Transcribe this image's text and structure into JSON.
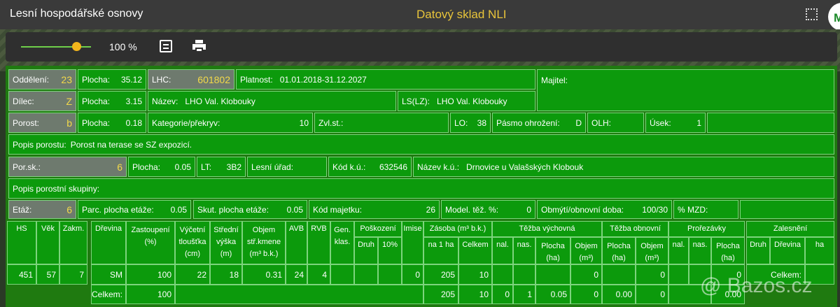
{
  "app": {
    "title": "Lesní hospodářské osnovy",
    "center_title": "Datový sklad NLI",
    "avatar_letter": "M"
  },
  "toolbar": {
    "zoom": "100 %",
    "zoom_percent": 100
  },
  "row1": {
    "oddeleni_label": "Oddělení:",
    "oddeleni_value": "23",
    "plocha_label": "Plocha:",
    "plocha_value": "35.12",
    "lhc_label": "LHC:",
    "lhc_value": "601802",
    "platnost_label": "Platnost:",
    "platnost_value": "01.01.2018-31.12.2027",
    "majitel_label": "Majitel:"
  },
  "row2": {
    "dilec_label": "Dílec:",
    "dilec_value": "Z",
    "plocha_label": "Plocha:",
    "plocha_value": "3.15",
    "nazev_label": "Název:",
    "nazev_value": "LHO Val. Klobouky",
    "ls_label": "LS(LZ):",
    "ls_value": "LHO Val. Klobouky"
  },
  "row3": {
    "porost_label": "Porost:",
    "porost_value": "b",
    "plocha_label": "Plocha:",
    "plocha_value": "0.18",
    "kategorie_label": "Kategorie/překryv:",
    "kategorie_value": "10",
    "zvl_label": "Zvl.st.:",
    "lo_label": "LO:",
    "lo_value": "38",
    "pasmo_label": "Pásmo ohrožení:",
    "pasmo_value": "D",
    "olh_label": "OLH:",
    "usek_label": "Úsek:",
    "usek_value": "1"
  },
  "row4": {
    "popis_label": "Popis porostu:",
    "popis_value": "Porost na terase se SZ expozicí."
  },
  "row5": {
    "porsk_label": "Por.sk.:",
    "porsk_value": "6",
    "plocha_label": "Plocha:",
    "plocha_value": "0.05",
    "lt_label": "LT:",
    "lt_value": "3B2",
    "urad_label": "Lesní úřad:",
    "kodku_label": "Kód k.ú.:",
    "kodku_value": "632546",
    "nazevku_label": "Název k.ú.:",
    "nazevku_value": "Drnovice u Valašských Klobouk"
  },
  "row6": {
    "popis_label": "Popis porostní skupiny:"
  },
  "row7": {
    "etaz_label": "Etáž:",
    "etaz_value": "6",
    "parc_label": "Parc. plocha etáže:",
    "parc_value": "0.05",
    "skut_label": "Skut. plocha etáže:",
    "skut_value": "0.05",
    "kodmaj_label": "Kód majetku:",
    "kodmaj_value": "26",
    "model_label": "Model. těž. %:",
    "model_value": "0",
    "obmyti_label": "Obmýtí/obnovní doba:",
    "obmyti_value": "100/30",
    "mzd_label": "% MZD:"
  },
  "table": {
    "h_hs": "HS",
    "h_vek": "Věk",
    "h_zakm": "Zakm.",
    "h_drevina": "Dřevina",
    "h_zast": "Zastoupení",
    "h_zast2": "(%)",
    "h_vyc": "Výčetní",
    "h_vyc2": "tloušťka",
    "h_vyc3": "(cm)",
    "h_str": "Střední",
    "h_str2": "výška",
    "h_str3": "(m)",
    "h_obj": "Objem",
    "h_obj2": "stř.kmene",
    "h_obj3": "(m³ b.k.)",
    "h_avb": "AVB",
    "h_rvb": "RVB",
    "h_gen": "Gen.",
    "h_gen2": "klas.",
    "h_posk": "Poškození",
    "h_druh": "Druh",
    "h_10": "10%",
    "h_imise": "Imise",
    "h_zasoba": "Zásoba (m³ b.k.)",
    "h_na1": "na 1 ha",
    "h_celkem": "Celkem",
    "h_tvych": "Těžba výchovná",
    "h_nal": "nal.",
    "h_nas": "nas.",
    "h_plocha": "Plocha",
    "h_ha": "(ha)",
    "h_objem": "Objem",
    "h_m3": "(m³)",
    "h_tobn": "Těžba obnovní",
    "h_proreз": "Prořezávky",
    "h_zales": "Zalesnění",
    "h_zdruh": "Druh",
    "h_zdrev": "Dřevina",
    "h_zha": "ha",
    "row": {
      "hs": "451",
      "vek": "57",
      "zakm": "7",
      "drevina": "SM",
      "zast": "100",
      "vyc": "22",
      "str": "18",
      "obj": "0.31",
      "avb": "24",
      "rvb": "4",
      "imise": "0",
      "na1": "205",
      "celkem": "10",
      "tv_obj": "0",
      "to_obj": "0",
      "pr_pl": "0",
      "zal_celkem": "Celkem:"
    },
    "total": {
      "label": "Celkem:",
      "zast": "100",
      "na1": "205",
      "celkem": "10",
      "tv_nal": "0",
      "tv_nas": "1",
      "tv_pl": "0.05",
      "tv_obj": "0",
      "to_pl": "0.00",
      "to_obj": "0",
      "pr_pl": "0.00"
    }
  },
  "watermark": "@ Bazos.cz"
}
